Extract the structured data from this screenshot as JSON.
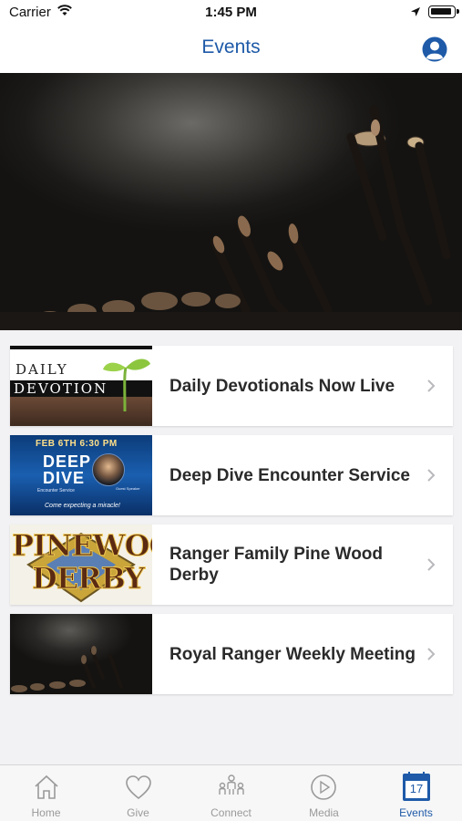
{
  "status_bar": {
    "carrier": "Carrier",
    "time": "1:45 PM"
  },
  "nav": {
    "title": "Events"
  },
  "events": [
    {
      "title": "Daily Devotionals Now Live",
      "thumb_text": [
        "DAILY",
        "DEVOTION"
      ]
    },
    {
      "title": "Deep Dive Encounter Service",
      "thumb_text": [
        "FEB 6TH  6:30 PM",
        "DEEP",
        "DIVE",
        "Encounter Service",
        "Guest Speaker",
        "Come expecting a miracle!"
      ]
    },
    {
      "title": "Ranger Family Pine Wood Derby",
      "thumb_text": [
        "PINEWOOD",
        "DERBY"
      ]
    },
    {
      "title": "Royal Ranger Weekly Meeting",
      "thumb_text": []
    }
  ],
  "tab_bar": {
    "active_color": "#1e5aa8",
    "inactive_color": "#9a9a9a",
    "items": [
      {
        "label": "Home",
        "icon": "home-icon"
      },
      {
        "label": "Give",
        "icon": "heart-icon"
      },
      {
        "label": "Connect",
        "icon": "people-icon"
      },
      {
        "label": "Media",
        "icon": "play-icon"
      },
      {
        "label": "Events",
        "icon": "calendar-icon",
        "calendar_day": "17",
        "active": true
      }
    ]
  }
}
